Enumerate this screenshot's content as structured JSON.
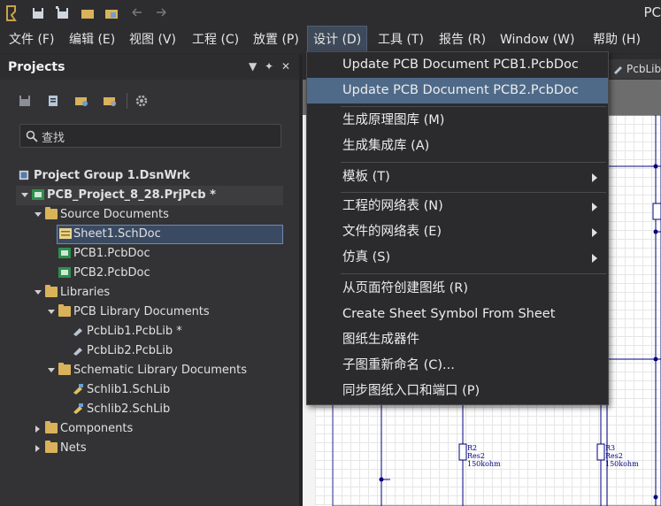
{
  "app": {
    "title_fragment": "PC"
  },
  "menubar": {
    "items": [
      {
        "label": "文件 (F)"
      },
      {
        "label": "编辑 (E)"
      },
      {
        "label": "视图 (V)"
      },
      {
        "label": "工程 (C)"
      },
      {
        "label": "放置 (P)"
      },
      {
        "label": "设计 (D)"
      },
      {
        "label": "工具 (T)"
      },
      {
        "label": "报告 (R)"
      },
      {
        "label": "Window (W)"
      },
      {
        "label": "帮助 (H)"
      }
    ]
  },
  "panel": {
    "title": "Projects",
    "search_placeholder": "查找",
    "tree": {
      "group": "Project Group 1.DsnWrk",
      "project": "PCB_Project_8_28.PrjPcb *",
      "source_docs": "Source Documents",
      "sheet1": "Sheet1.SchDoc",
      "pcb1": "PCB1.PcbDoc",
      "pcb2": "PCB2.PcbDoc",
      "libraries": "Libraries",
      "pcb_lib_docs": "PCB Library Documents",
      "pcblib1": "PcbLib1.PcbLib *",
      "pcblib2": "PcbLib2.PcbLib",
      "sch_lib_docs": "Schematic Library Documents",
      "schlib1": "Schlib1.SchLib",
      "schlib2": "Schlib2.SchLib",
      "components": "Components",
      "nets": "Nets"
    }
  },
  "doc": {
    "tab_label": "PcbLib",
    "r2": {
      "ref": "R2",
      "val": "Res2",
      "ohm": "150kohm"
    },
    "r3": {
      "ref": "R3",
      "val": "Res2",
      "ohm": "150kohm"
    }
  },
  "dropdown": {
    "items": [
      {
        "label": "Update PCB Document PCB1.PcbDoc"
      },
      {
        "label": "Update PCB Document PCB2.PcbDoc"
      },
      {
        "label": "生成原理图库 (M)"
      },
      {
        "label": "生成集成库 (A)"
      },
      {
        "label": "模板 (T)"
      },
      {
        "label": "工程的网络表 (N)"
      },
      {
        "label": "文件的网络表 (E)"
      },
      {
        "label": "仿真 (S)"
      },
      {
        "label": "从页面符创建图纸 (R)"
      },
      {
        "label": "Create Sheet Symbol From Sheet"
      },
      {
        "label": "图纸生成器件"
      },
      {
        "label": "子图重新命名 (C)..."
      },
      {
        "label": "同步图纸入口和端口 (P)"
      }
    ]
  },
  "colors": {
    "accent": "#4f6a88",
    "folder": "#d9b25a",
    "schematic_wire": "#00007f"
  }
}
